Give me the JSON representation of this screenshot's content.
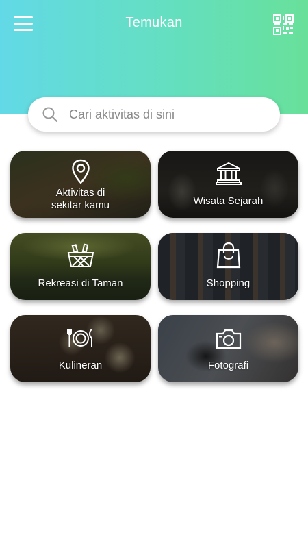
{
  "header": {
    "title": "Temukan",
    "menu_icon": "hamburger-menu-icon",
    "qr_icon": "qr-code-icon",
    "gradient_colors": [
      "#62d9e6",
      "#68e09a"
    ]
  },
  "search": {
    "placeholder": "Cari aktivitas di sini",
    "value": "",
    "icon": "search-icon"
  },
  "categories": [
    {
      "line1": "Aktivitas di",
      "line2": "sekitar kamu",
      "icon": "map-pin-icon"
    },
    {
      "line1": "Wisata Sejarah",
      "line2": "",
      "icon": "museum-icon"
    },
    {
      "line1": "Rekreasi di Taman",
      "line2": "",
      "icon": "picnic-basket-icon"
    },
    {
      "line1": "Shopping",
      "line2": "",
      "icon": "shopping-bag-icon"
    },
    {
      "line1": "Kulineran",
      "line2": "",
      "icon": "plate-cutlery-icon"
    },
    {
      "line1": "Fotografi",
      "line2": "",
      "icon": "camera-icon"
    }
  ]
}
